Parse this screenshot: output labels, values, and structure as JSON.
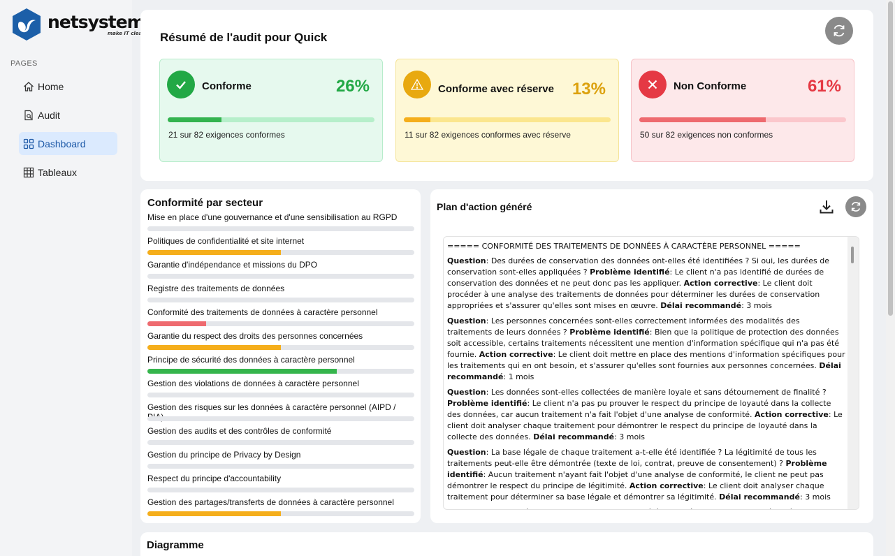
{
  "brand": {
    "name": "netsystem",
    "tagline": "make IT clear",
    "color": "#1c5fa8"
  },
  "sidebar": {
    "section_label": "PAGES",
    "items": [
      {
        "label": "Home",
        "icon": "home-icon",
        "active": false
      },
      {
        "label": "Audit",
        "icon": "audit-icon",
        "active": false
      },
      {
        "label": "Dashboard",
        "icon": "dashboard-icon",
        "active": true
      },
      {
        "label": "Tableaux",
        "icon": "table-icon",
        "active": false
      }
    ]
  },
  "summary": {
    "title": "Résumé de l'audit pour Quick",
    "cards": [
      {
        "label": "Conforme",
        "percent": "26%",
        "fraction": 0.26,
        "subtitle": "21 sur 82 exigences conformes",
        "icon": "check-icon",
        "color": "#22a845"
      },
      {
        "label": "Conforme avec réserve",
        "percent": "13%",
        "fraction": 0.13,
        "subtitle": "11 sur 82 exigences conformes avec réserve",
        "icon": "warning-icon",
        "color": "#e8a910"
      },
      {
        "label": "Non Conforme",
        "percent": "61%",
        "fraction": 0.61,
        "subtitle": "50 sur 82 exigences non conformes",
        "icon": "close-icon",
        "color": "#e53944"
      }
    ]
  },
  "sectors": {
    "title": "Conformité par secteur",
    "items": [
      {
        "name": "Mise en place d'une gouvernance et d'une sensibilisation au RGPD",
        "fraction": 0,
        "color": "#f5ae1b"
      },
      {
        "name": "Politiques de confidentialité et site internet",
        "fraction": 0.5,
        "color": "#f5ae1b"
      },
      {
        "name": "Garantie d'indépendance et missions du DPO",
        "fraction": 0,
        "color": "#f5ae1b"
      },
      {
        "name": "Registre des traitements de données",
        "fraction": 0,
        "color": "#f5ae1b"
      },
      {
        "name": "Conformité des traitements de données à caractère personnel",
        "fraction": 0.22,
        "color": "#ee6a6f"
      },
      {
        "name": "Garantie du respect des droits des personnes concernées",
        "fraction": 0.5,
        "color": "#f5ae1b"
      },
      {
        "name": "Principe de sécurité des données à caractère personnel",
        "fraction": 0.71,
        "color": "#35b54c"
      },
      {
        "name": "Gestion des violations de données à caractère personnel",
        "fraction": 0,
        "color": "#f5ae1b"
      },
      {
        "name": "Gestion des risques sur les données à caractère personnel (AIPD / PIA)",
        "fraction": 0,
        "color": "#f5ae1b"
      },
      {
        "name": "Gestion des audits et des contrôles de conformité",
        "fraction": 0,
        "color": "#f5ae1b"
      },
      {
        "name": "Gestion du principe de Privacy by Design",
        "fraction": 0,
        "color": "#f5ae1b"
      },
      {
        "name": "Respect du principe d'accountability",
        "fraction": 0,
        "color": "#f5ae1b"
      },
      {
        "name": "Gestion des partages/transferts de données à caractère personnel",
        "fraction": 0.5,
        "color": "#f5ae1b"
      }
    ]
  },
  "plan": {
    "title": "Plan d'action généré",
    "heading": "===== CONFORMITÉ DES TRAITEMENTS DE DONNÉES À CARACTÈRE PERSONNEL =====",
    "labels": {
      "question": "Question",
      "problem": "Problème identifié",
      "action": "Action corrective",
      "delay": "Délai recommandé"
    },
    "entries": [
      {
        "question": "Des durées de conservation des données ont-elles été identifiées ? Si oui, les durées de conservation sont-elles appliquées ?",
        "problem": "Le client n'a pas identifié de durées de conservation des données et ne peut donc pas les appliquer.",
        "action": "Le client doit procéder à une analyse des traitements de données pour déterminer les durées de conservation appropriées et s'assurer qu'elles sont mises en œuvre.",
        "delay": "3 mois"
      },
      {
        "question": "Les personnes concernées sont-elles correctement informées des modalités des traitements de leurs données ?",
        "problem": "Bien que la politique de protection des données soit accessible, certains traitements nécessitent une mention d'information spécifique qui n'a pas été fournie.",
        "action": "Le client doit mettre en place des mentions d'information spécifiques pour les traitements qui en ont besoin, et s'assurer qu'elles sont fournies aux personnes concernées.",
        "delay": "1 mois"
      },
      {
        "question": "Les données sont-elles collectées de manière loyale et sans détournement de finalité ?",
        "problem": "Le client n'a pas pu prouver le respect du principe de loyauté dans la collecte des données, car aucun traitement n'a fait l'objet d'une analyse de conformité.",
        "action": "Le client doit analyser chaque traitement pour démontrer le respect du principe de loyauté dans la collecte des données.",
        "delay": "3 mois"
      },
      {
        "question": "La base légale de chaque traitement a-t-elle été identifiée ? La légitimité de tous les traitements peut-elle être démontrée (texte de loi, contrat, preuve de consentement) ?",
        "problem": "Aucun traitement n'ayant fait l'objet d'une analyse de conformité, le client ne peut pas démontrer le respect du principe de légitimité.",
        "action": "Le client doit analyser chaque traitement pour déterminer sa base légale et démontrer sa légitimité.",
        "delay": "3 mois"
      },
      {
        "question": "La finalité de chaque traitement a-t-elle été identifiée ? Seules les données nécessaires pour",
        "problem": "",
        "action": "",
        "delay": ""
      }
    ]
  },
  "diagram": {
    "title": "Diagramme"
  }
}
